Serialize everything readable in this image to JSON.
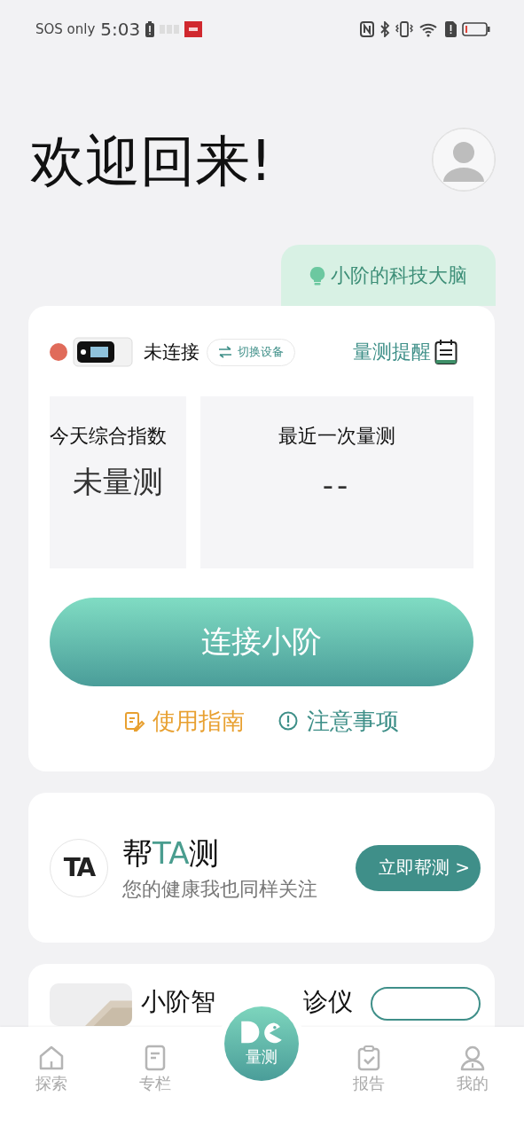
{
  "status_bar": {
    "carrier": "SOS only",
    "time": "5:03"
  },
  "header": {
    "title": "欢迎回来!"
  },
  "brain_tab": {
    "label": "小阶的科技大脑"
  },
  "device": {
    "connected": false,
    "status": "未连接",
    "switch_label": "切换设备",
    "reminder": "量测提醒",
    "stats": [
      {
        "label": "今天综合指数",
        "value": "未量测"
      },
      {
        "label": "最近一次量测",
        "value": "--"
      }
    ],
    "connect_button": "连接小阶",
    "links": [
      {
        "kind": "guide",
        "label": "使用指南"
      },
      {
        "kind": "notice",
        "label": "注意事项"
      }
    ]
  },
  "help_card": {
    "logo": "TA",
    "title": [
      {
        "text": "帮",
        "accent": false
      },
      {
        "text": "TA",
        "accent": true
      },
      {
        "text": "测",
        "accent": false
      }
    ],
    "subtitle": "您的健康我也同样关注",
    "button": "立即帮测 >"
  },
  "product_card": {
    "kind": "picture",
    "title_start": "小阶智",
    "title_end": "诊仪"
  },
  "nav": {
    "items": [
      {
        "kind": "home",
        "label": "探索",
        "selected": false
      },
      {
        "kind": "column",
        "label": "专栏",
        "selected": false
      },
      {
        "kind": "center",
        "label": "量测",
        "selected": true
      },
      {
        "kind": "report",
        "label": "报告",
        "selected": false
      },
      {
        "kind": "profile",
        "label": "我的",
        "selected": false
      }
    ]
  }
}
